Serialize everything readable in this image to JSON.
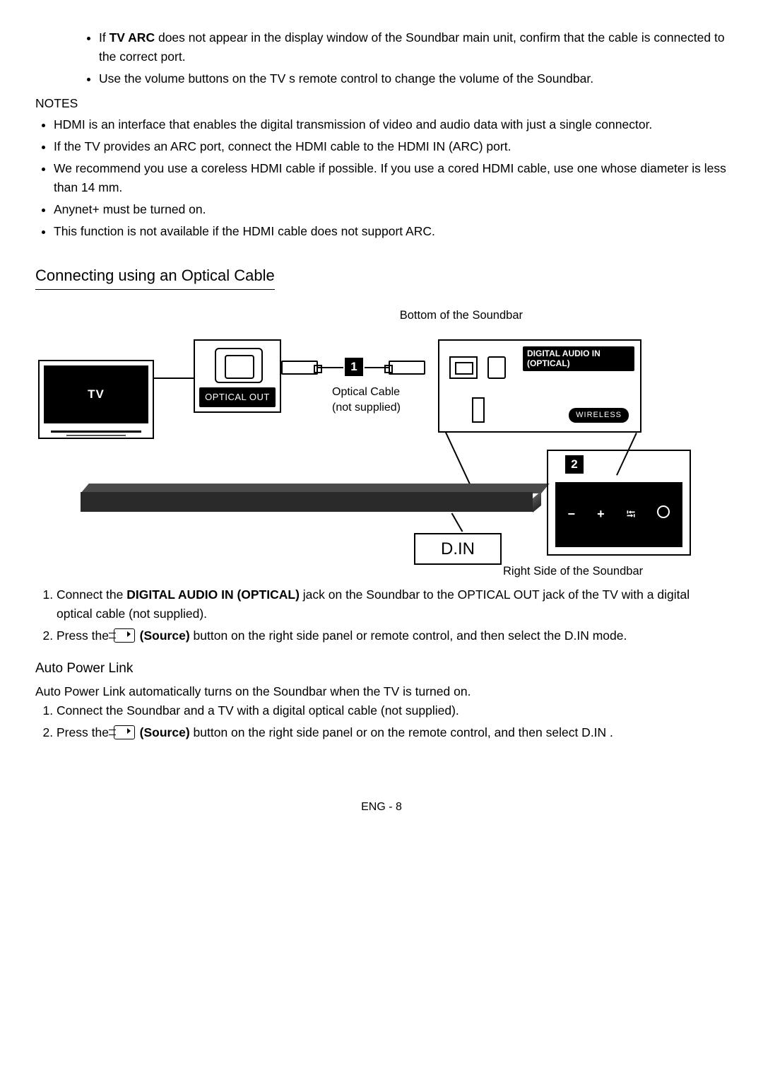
{
  "intro_bullets": [
    {
      "prefix": "If ",
      "bold": "TV ARC",
      "rest": " does not appear in the display window of the Soundbar main unit, confirm that the cable is connected to the correct port."
    },
    {
      "prefix": "",
      "bold": "",
      "rest": "Use the volume buttons on the TV s remote control to change the volume of the Soundbar."
    }
  ],
  "notes_heading": "NOTES",
  "notes_bullets": [
    "HDMI is an interface that enables the digital transmission of video and audio data with just a single connector.",
    "If the TV provides an ARC port, connect the HDMI cable to the HDMI IN (ARC) port.",
    "We recommend you use a coreless HDMI cable if possible. If you use a cored HDMI cable, use one whose diameter is less than 14 mm.",
    "Anynet+ must be turned on.",
    "This function is not available if the HDMI cable does not support ARC."
  ],
  "section_title": "Connecting using an Optical Cable",
  "diagram": {
    "bottom_label": "Bottom of the Soundbar",
    "tv_label": "TV",
    "optical_out": "OPTICAL OUT",
    "cable_line1": "Optical Cable",
    "cable_line2": "(not supplied)",
    "dai_line1": "DIGITAL AUDIO IN",
    "dai_line2": "(OPTICAL)",
    "wireless": "WIRELESS",
    "num1": "1",
    "num2": "2",
    "din": "D.IN",
    "side_minus": "−",
    "side_plus": "+",
    "right_label": "Right Side of the Soundbar"
  },
  "steps_main": [
    {
      "pre": "Connect the",
      "bold": " DIGITAL AUDIO IN (OPTICAL) ",
      "post": "jack on the Soundbar to the OPTICAL OUT jack of the TV with a digital optical cable (not supplied)."
    },
    {
      "pre": "Press the ",
      "icon": true,
      "bold": " (Source) ",
      "post": "button on the right side panel or remote control, and then select the  D.IN mode."
    }
  ],
  "apl_heading": "Auto Power Link",
  "apl_intro": "Auto Power Link automatically turns on the Soundbar when the TV is turned on.",
  "apl_steps": [
    {
      "pre": "Connect the Soundbar and a TV with a digital optical cable (not supplied).",
      "icon": false,
      "bold": "",
      "post": ""
    },
    {
      "pre": "Press the ",
      "icon": true,
      "bold": " (Source) ",
      "post": "button on the right side panel or on the remote control, and then select D.IN ."
    }
  ],
  "footer": "ENG - 8"
}
